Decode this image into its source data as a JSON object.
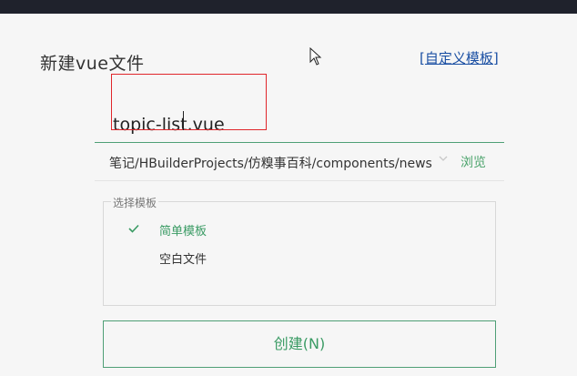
{
  "dialog": {
    "title": "新建vue文件",
    "custom_template_link": "[自定义模板]"
  },
  "filename": {
    "value": "topic-list.vue"
  },
  "path": {
    "value": "笔记/HBuilderProjects/仿糗事百科/components/news",
    "browse_label": "浏览"
  },
  "templates": {
    "legend": "选择模板",
    "items": [
      {
        "label": "简单模板",
        "selected": true
      },
      {
        "label": "空白文件",
        "selected": false
      }
    ]
  },
  "actions": {
    "create_label": "创建(N)"
  },
  "colors": {
    "accent": "#3a9b64",
    "link": "#1a4fa3",
    "highlight": "#e0262b"
  }
}
